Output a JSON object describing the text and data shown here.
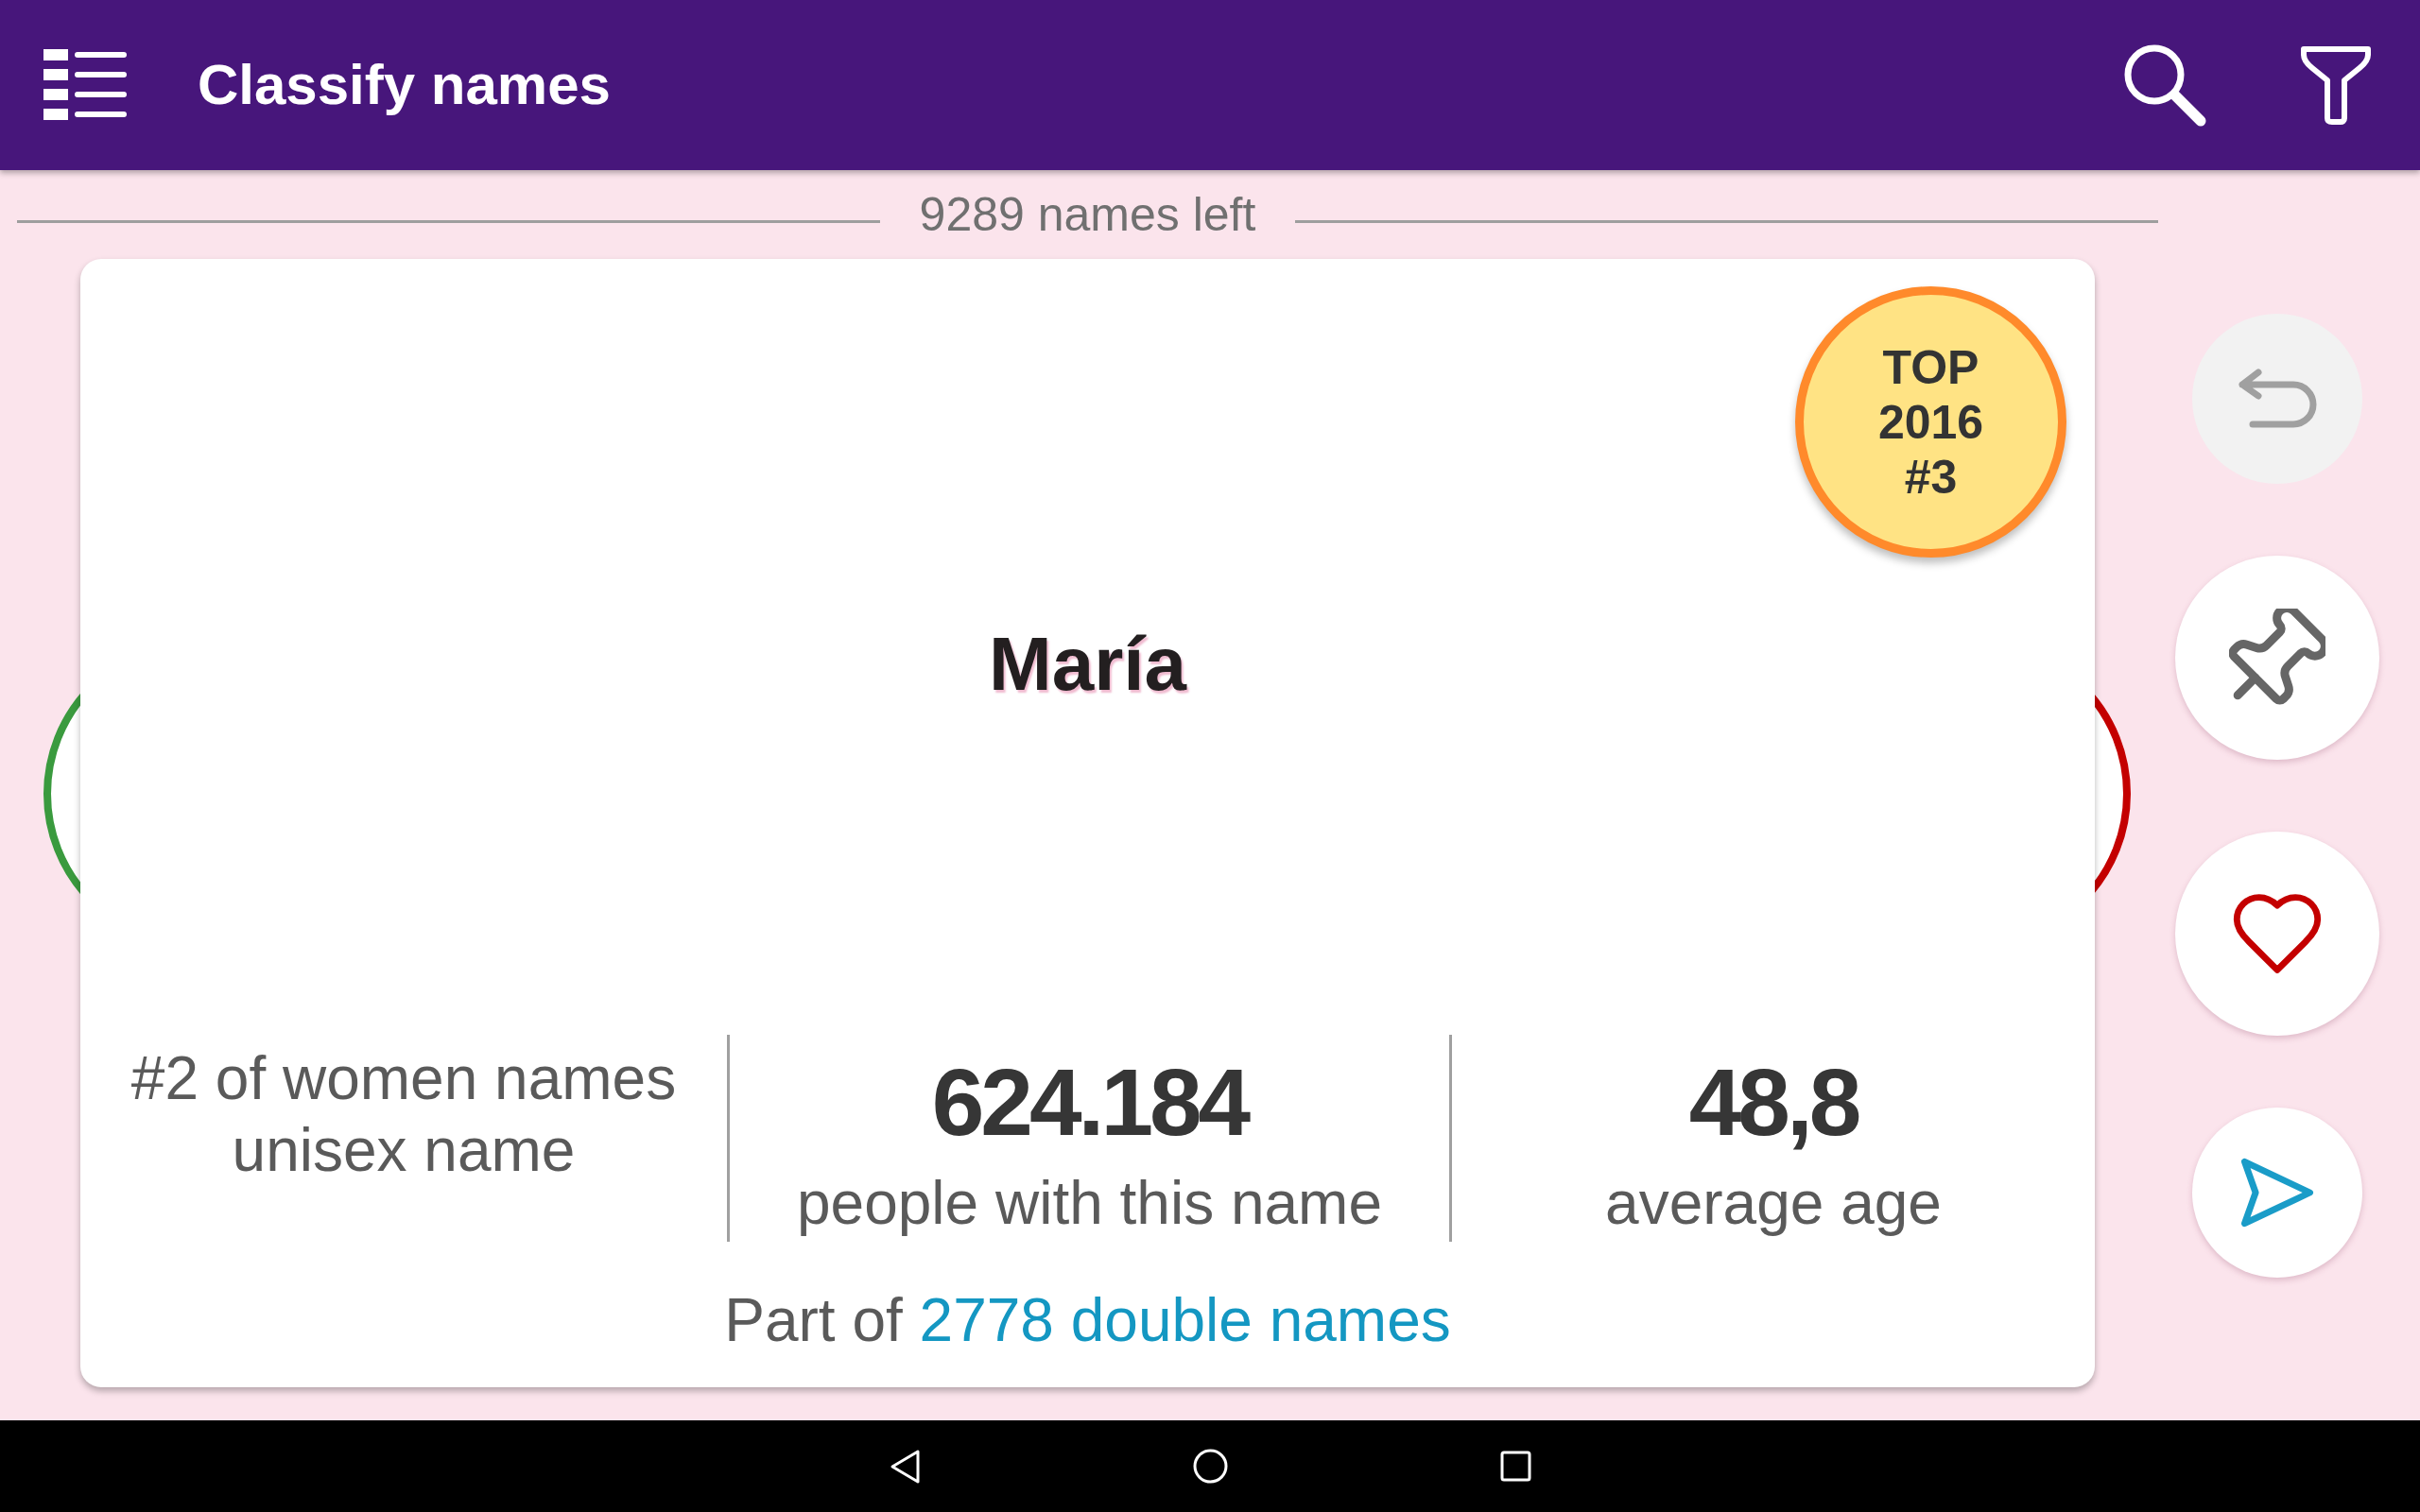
{
  "app_bar": {
    "title": "Classify names"
  },
  "counter": "9289 names left",
  "card": {
    "name": "María",
    "badge": [
      "TOP",
      "2016",
      "#3"
    ],
    "rank_lines": [
      "#2 of women names",
      "unisex name"
    ],
    "stats": [
      {
        "value": "624.184",
        "label": "people with this name"
      },
      {
        "value": "48,8",
        "label": "average age"
      }
    ],
    "double_names": {
      "prefix": "Part of",
      "link": "2778 double names"
    }
  },
  "actions": [
    {
      "kind": "undo",
      "disabled": true
    },
    {
      "kind": "pin",
      "disabled": false
    },
    {
      "kind": "heart",
      "disabled": false
    },
    {
      "kind": "send",
      "disabled": false
    }
  ]
}
